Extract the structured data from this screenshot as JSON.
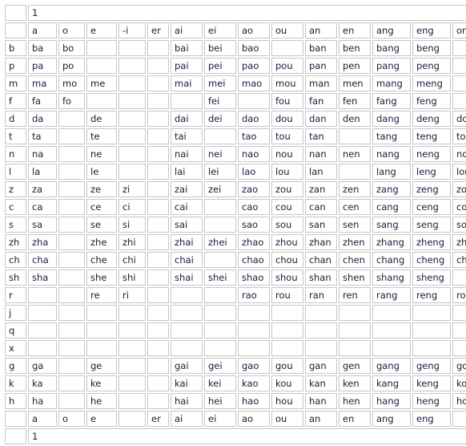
{
  "page": {
    "top_banner": "1",
    "bottom_banner": "1"
  },
  "columns": [
    "",
    "a",
    "o",
    "e",
    "-i",
    "er",
    "ai",
    "ei",
    "ao",
    "ou",
    "an",
    "en",
    "ang",
    "eng",
    "ong"
  ],
  "footer_columns": [
    "",
    "a",
    "o",
    "e",
    "",
    "er",
    "ai",
    "ei",
    "ao",
    "ou",
    "an",
    "en",
    "ang",
    "eng",
    ""
  ],
  "rows": [
    {
      "initial": "b",
      "cells": [
        "ba",
        "bo",
        "",
        "",
        "",
        "bai",
        "bei",
        "bao",
        "",
        "ban",
        "ben",
        "bang",
        "beng",
        ""
      ]
    },
    {
      "initial": "p",
      "cells": [
        "pa",
        "po",
        "",
        "",
        "",
        "pai",
        "pei",
        "pao",
        "pou",
        "pan",
        "pen",
        "pang",
        "peng",
        ""
      ]
    },
    {
      "initial": "m",
      "cells": [
        "ma",
        "mo",
        "me",
        "",
        "",
        "mai",
        "mei",
        "mao",
        "mou",
        "man",
        "men",
        "mang",
        "meng",
        ""
      ]
    },
    {
      "initial": "f",
      "cells": [
        "fa",
        "fo",
        "",
        "",
        "",
        "",
        "fei",
        "",
        "fou",
        "fan",
        "fen",
        "fang",
        "feng",
        ""
      ]
    },
    {
      "initial": "d",
      "cells": [
        "da",
        "",
        "de",
        "",
        "",
        "dai",
        "dei",
        "dao",
        "dou",
        "dan",
        "den",
        "dang",
        "deng",
        "dong"
      ]
    },
    {
      "initial": "t",
      "cells": [
        "ta",
        "",
        "te",
        "",
        "",
        "tai",
        "",
        "tao",
        "tou",
        "tan",
        "",
        "tang",
        "teng",
        "tong"
      ]
    },
    {
      "initial": "n",
      "cells": [
        "na",
        "",
        "ne",
        "",
        "",
        "nai",
        "nei",
        "nao",
        "nou",
        "nan",
        "nen",
        "nang",
        "neng",
        "nong"
      ]
    },
    {
      "initial": "l",
      "cells": [
        "la",
        "",
        "le",
        "",
        "",
        "lai",
        "lei",
        "lao",
        "lou",
        "lan",
        "",
        "lang",
        "leng",
        "long"
      ]
    },
    {
      "initial": "z",
      "cells": [
        "za",
        "",
        "ze",
        "zi",
        "",
        "zai",
        "zei",
        "zao",
        "zou",
        "zan",
        "zen",
        "zang",
        "zeng",
        "zong"
      ]
    },
    {
      "initial": "c",
      "cells": [
        "ca",
        "",
        "ce",
        "ci",
        "",
        "cai",
        "",
        "cao",
        "cou",
        "can",
        "cen",
        "cang",
        "ceng",
        "cong"
      ]
    },
    {
      "initial": "s",
      "cells": [
        "sa",
        "",
        "se",
        "si",
        "",
        "sai",
        "",
        "sao",
        "sou",
        "san",
        "sen",
        "sang",
        "seng",
        "song"
      ]
    },
    {
      "initial": "zh",
      "cells": [
        "zha",
        "",
        "zhe",
        "zhi",
        "",
        "zhai",
        "zhei",
        "zhao",
        "zhou",
        "zhan",
        "zhen",
        "zhang",
        "zheng",
        "zhong"
      ]
    },
    {
      "initial": "ch",
      "cells": [
        "cha",
        "",
        "che",
        "chi",
        "",
        "chai",
        "",
        "chao",
        "chou",
        "chan",
        "chen",
        "chang",
        "cheng",
        "chong"
      ]
    },
    {
      "initial": "sh",
      "cells": [
        "sha",
        "",
        "she",
        "shi",
        "",
        "shai",
        "shei",
        "shao",
        "shou",
        "shan",
        "shen",
        "shang",
        "sheng",
        ""
      ]
    },
    {
      "initial": "r",
      "cells": [
        "",
        "",
        "re",
        "ri",
        "",
        "",
        "",
        "rao",
        "rou",
        "ran",
        "ren",
        "rang",
        "reng",
        "rong"
      ]
    },
    {
      "initial": "j",
      "cells": [
        "",
        "",
        "",
        "",
        "",
        "",
        "",
        "",
        "",
        "",
        "",
        "",
        "",
        ""
      ]
    },
    {
      "initial": "q",
      "cells": [
        "",
        "",
        "",
        "",
        "",
        "",
        "",
        "",
        "",
        "",
        "",
        "",
        "",
        ""
      ]
    },
    {
      "initial": "x",
      "cells": [
        "",
        "",
        "",
        "",
        "",
        "",
        "",
        "",
        "",
        "",
        "",
        "",
        "",
        ""
      ]
    },
    {
      "initial": "g",
      "cells": [
        "ga",
        "",
        "ge",
        "",
        "",
        "gai",
        "gei",
        "gao",
        "gou",
        "gan",
        "gen",
        "gang",
        "geng",
        "gong"
      ]
    },
    {
      "initial": "k",
      "cells": [
        "ka",
        "",
        "ke",
        "",
        "",
        "kai",
        "kei",
        "kao",
        "kou",
        "kan",
        "ken",
        "kang",
        "keng",
        "kong"
      ]
    },
    {
      "initial": "h",
      "cells": [
        "ha",
        "",
        "he",
        "",
        "",
        "hai",
        "hei",
        "hao",
        "hou",
        "han",
        "hen",
        "hang",
        "heng",
        "hong"
      ]
    },
    {
      "initial": "",
      "cells": [
        "a",
        "o",
        "e",
        "",
        "er",
        "ai",
        "ei",
        "ao",
        "ou",
        "an",
        "en",
        "ang",
        "eng",
        ""
      ]
    }
  ],
  "colors": {
    "cell_border": "#c6c6c6",
    "text": "#1b1b3a",
    "background": "#ffffff"
  }
}
